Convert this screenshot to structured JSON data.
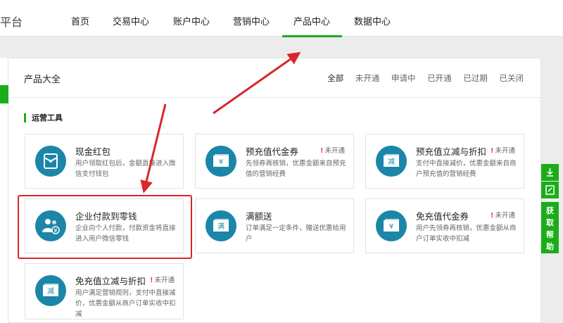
{
  "header": {
    "brand": "平台",
    "nav": [
      {
        "label": "首页"
      },
      {
        "label": "交易中心"
      },
      {
        "label": "账户中心"
      },
      {
        "label": "营销中心"
      },
      {
        "label": "产品中心"
      },
      {
        "label": "数据中心"
      }
    ]
  },
  "panel": {
    "title": "产品大全",
    "filters": [
      "全部",
      "未开通",
      "申请中",
      "已开通",
      "已过期",
      "已关闭"
    ],
    "section_title": "运营工具"
  },
  "cards": [
    {
      "title": "现金红包",
      "desc": "用户领取红包后，金额直接进入微信支付钱包",
      "badge": "",
      "icon": "envelope-icon"
    },
    {
      "title": "预充值代金券",
      "desc": "先领券再核销，优惠金额来自预充值的营销经费",
      "badge": "未开通",
      "icon": "yuan-voucher-icon"
    },
    {
      "title": "预充值立减与折扣",
      "desc": "支付中直接减价，优惠金额来自商户预充值的营销经费",
      "badge": "未开通",
      "icon": "discount-ticket-icon"
    },
    {
      "title": "企业付款到零钱",
      "desc": "企业向个人付款，付款资金将直接进入用户微信零钱",
      "badge": "",
      "icon": "users-payment-icon"
    },
    {
      "title": "满额送",
      "desc": "订单满足一定条件，赠送优惠给用户",
      "badge": "",
      "icon": "full-gift-icon"
    },
    {
      "title": "免充值代金券",
      "desc": "用户先领券再核销，优惠金额从商户订单实收中扣减",
      "badge": "未开通",
      "icon": "yuan-voucher-icon"
    },
    {
      "title": "免充值立减与折扣",
      "desc": "用户满足营销规则，支付中直接减价，优惠金额从商户订单实收中扣减",
      "badge": "未开通",
      "icon": "discount-ticket-icon"
    }
  ],
  "icon_glyphs": {
    "full": "满",
    "discount": "减",
    "yuan": "¥"
  },
  "sidebar": {
    "help_label": [
      "获",
      "取",
      "帮",
      "助"
    ]
  },
  "colors": {
    "accent": "#1aad19",
    "icon_bg": "#1b86a8",
    "highlight": "#d9272a",
    "arrow": "#d9272a"
  }
}
